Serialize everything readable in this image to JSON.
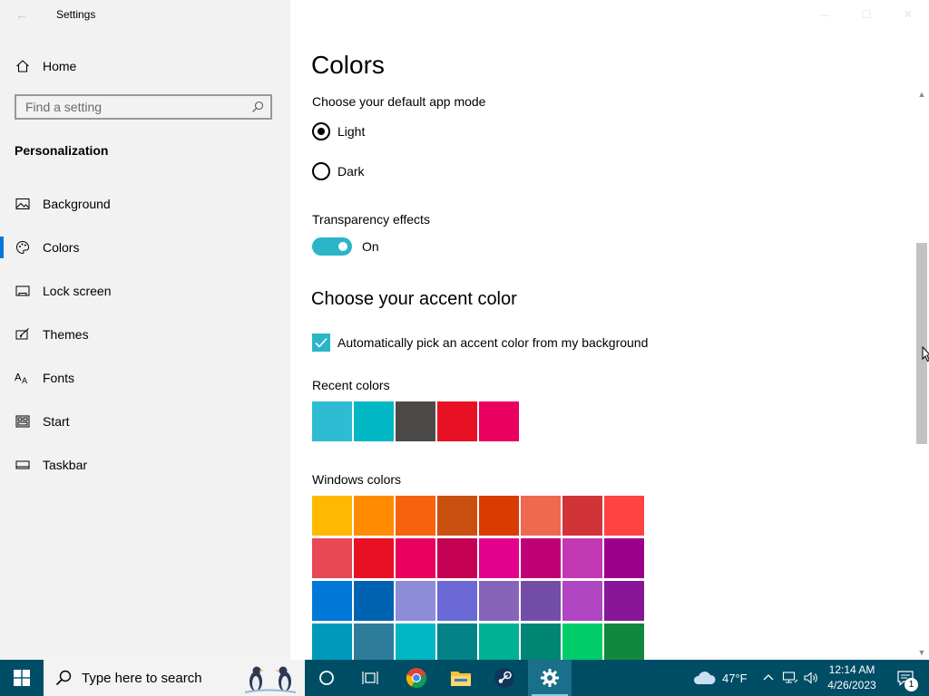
{
  "window": {
    "title": "Settings",
    "back_glyph": "←"
  },
  "sidebar": {
    "home_label": "Home",
    "search_placeholder": "Find a setting",
    "section_title": "Personalization",
    "items": [
      {
        "label": "Background",
        "icon": "picture-icon"
      },
      {
        "label": "Colors",
        "icon": "palette-icon",
        "selected": true
      },
      {
        "label": "Lock screen",
        "icon": "lock-screen-icon"
      },
      {
        "label": "Themes",
        "icon": "themes-icon"
      },
      {
        "label": "Fonts",
        "icon": "fonts-icon"
      },
      {
        "label": "Start",
        "icon": "start-icon"
      },
      {
        "label": "Taskbar",
        "icon": "taskbar-icon"
      }
    ]
  },
  "main": {
    "page_title": "Colors",
    "app_mode_label": "Choose your default app mode",
    "app_mode_options": [
      "Light",
      "Dark"
    ],
    "app_mode_selected": "Light",
    "transparency_label": "Transparency effects",
    "transparency_state": "On",
    "accent_heading": "Choose your accent color",
    "auto_accent_label": "Automatically pick an accent color from my background",
    "auto_accent_checked": true,
    "recent_colors_label": "Recent colors",
    "recent_colors": [
      "#2dbcd2",
      "#00b7c3",
      "#4c4a48",
      "#e81123",
      "#ea005e"
    ],
    "windows_colors_label": "Windows colors",
    "windows_colors": [
      "#ffb900",
      "#ff8c00",
      "#f7630c",
      "#ca5010",
      "#da3b01",
      "#ef6950",
      "#d13438",
      "#ff4343",
      "#e74856",
      "#e81123",
      "#ea005e",
      "#c30052",
      "#e3008c",
      "#bf0077",
      "#c239b3",
      "#9a0089",
      "#0078d7",
      "#0063b1",
      "#8e8cd8",
      "#6b69d6",
      "#8764b8",
      "#744da9",
      "#b146c2",
      "#881798",
      "#0099bc",
      "#2d7d9a",
      "#00b7c3",
      "#038387",
      "#00b294",
      "#018574",
      "#00cc6a",
      "#10893e"
    ]
  },
  "taskbar": {
    "search_text": "Type here to search",
    "weather_temp": "47°F",
    "time": "12:14 AM",
    "date": "4/26/2023",
    "notification_count": "1"
  },
  "colors": {
    "accent": "#2bb5c7",
    "taskbar": "#004d66",
    "sidebar_bg": "#f2f2f2"
  }
}
